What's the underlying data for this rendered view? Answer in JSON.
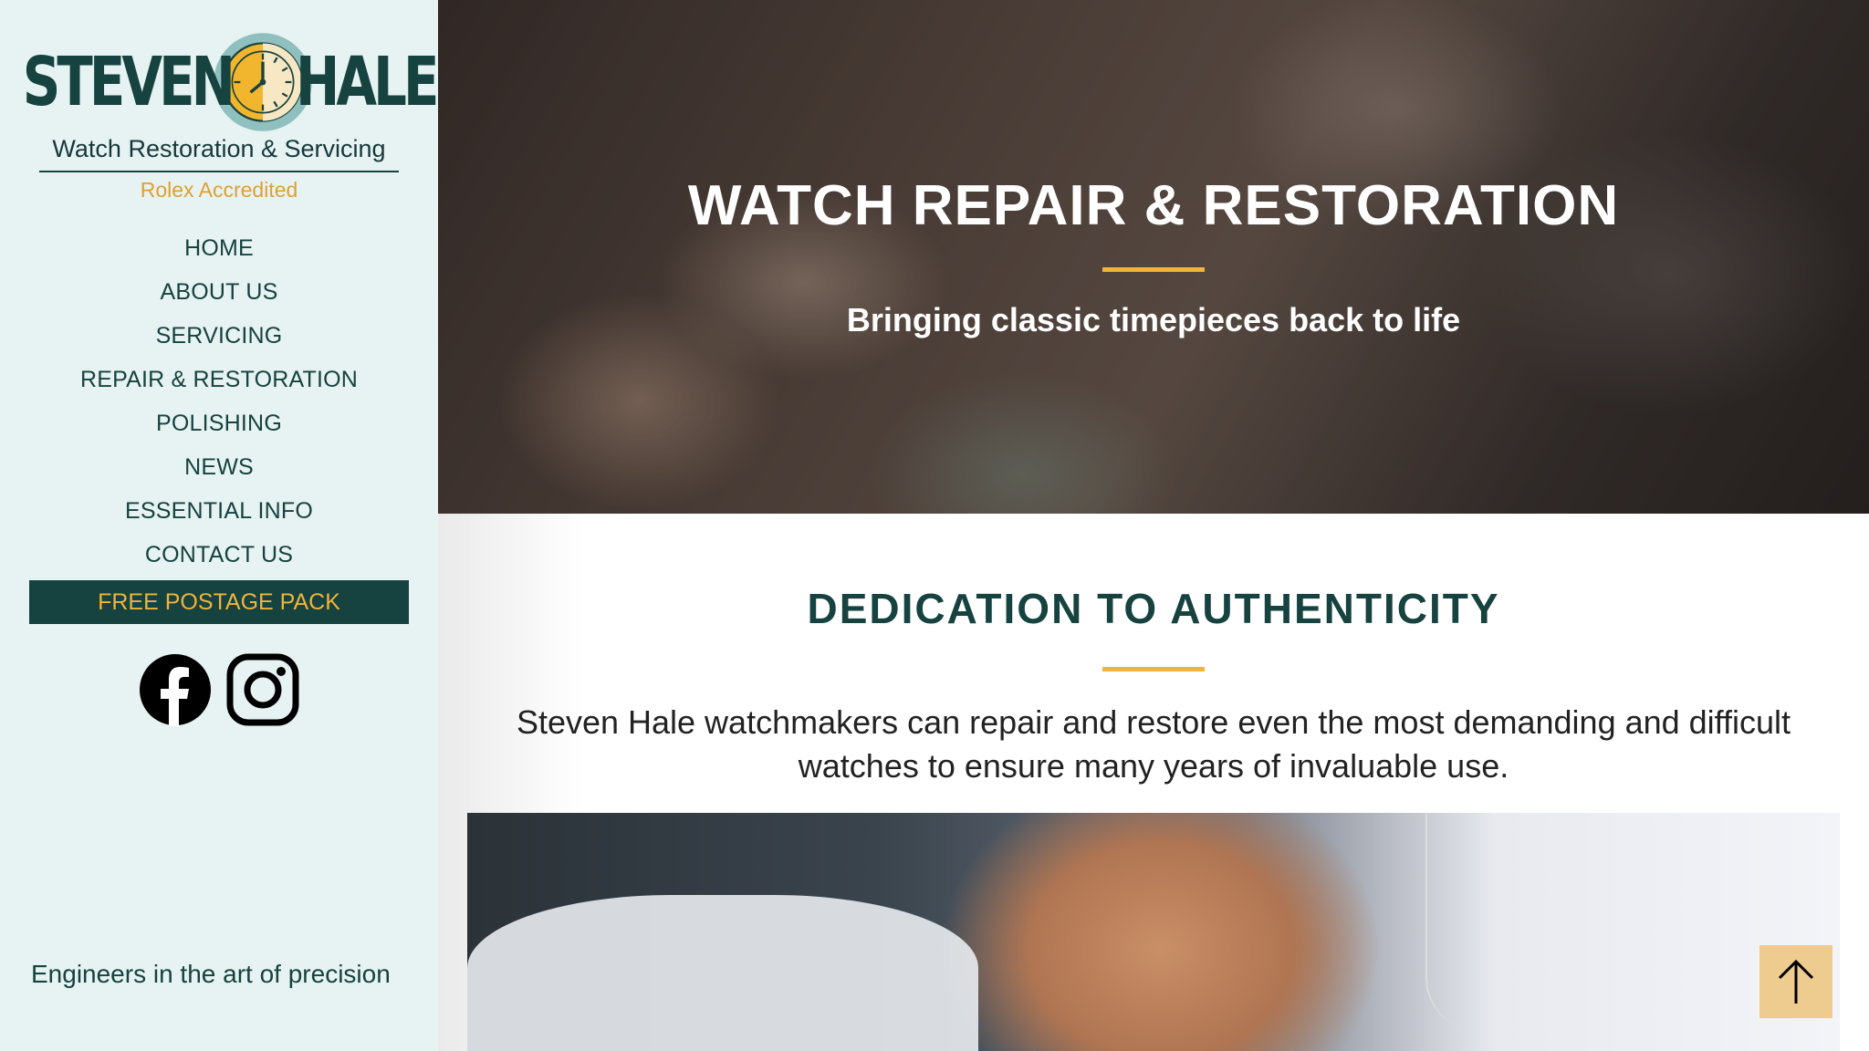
{
  "brand": {
    "name_left": "STEVEN",
    "name_right": "HALE",
    "subtitle": "Watch Restoration & Servicing",
    "accreditation": "Rolex Accredited"
  },
  "nav": {
    "items": [
      {
        "label": "HOME"
      },
      {
        "label": "ABOUT US"
      },
      {
        "label": "SERVICING"
      },
      {
        "label": "REPAIR & RESTORATION"
      },
      {
        "label": "POLISHING"
      },
      {
        "label": "NEWS"
      },
      {
        "label": "ESSENTIAL INFO"
      },
      {
        "label": "CONTACT US"
      }
    ],
    "cta": "FREE POSTAGE PACK"
  },
  "social": {
    "icons": [
      "facebook-icon",
      "instagram-icon"
    ]
  },
  "sidebar": {
    "tagline": "Engineers in the art of precision"
  },
  "hero": {
    "title": "WATCH REPAIR & RESTORATION",
    "subtitle": "Bringing classic timepieces back to life"
  },
  "section": {
    "title": "DEDICATION TO AUTHENTICITY",
    "body": "Steven Hale watchmakers can repair and restore even the most demanding and difficult watches to ensure many years of invaluable use."
  },
  "colors": {
    "primary": "#16423f",
    "accent": "#f0b43a",
    "sidebar_bg": "#e6f3f2",
    "to_top_bg": "#eecb8f"
  }
}
